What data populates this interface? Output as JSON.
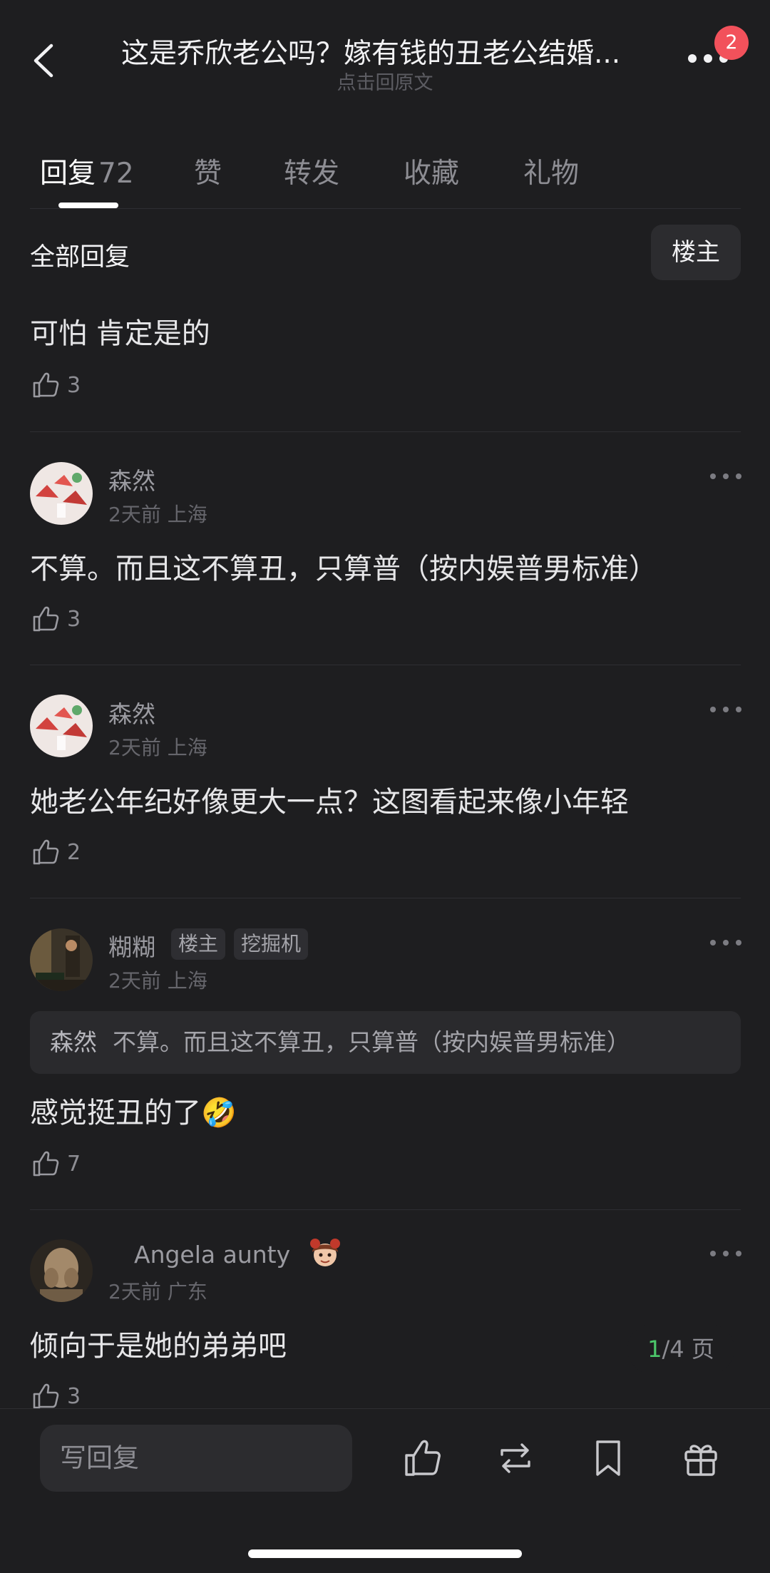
{
  "header": {
    "title": "这是乔欣老公吗？嫁有钱的丑老公结婚...",
    "subtitle": "点击回原文",
    "notification_count": "2"
  },
  "tabs": [
    {
      "label": "回复",
      "count": "72",
      "active": true
    },
    {
      "label": "赞"
    },
    {
      "label": "转发"
    },
    {
      "label": "收藏"
    },
    {
      "label": "礼物"
    }
  ],
  "section": {
    "title": "全部回复",
    "filter_label": "楼主"
  },
  "comments": [
    {
      "text": "可怕 肯定是的",
      "likes": "3"
    },
    {
      "user": "森然",
      "meta": "2天前 上海",
      "text": "不算。而且这不算丑，只算普（按内娱普男标准）",
      "likes": "3"
    },
    {
      "user": "森然",
      "meta": "2天前 上海",
      "text": "她老公年纪好像更大一点？这图看起来像小年轻",
      "likes": "2"
    },
    {
      "user": "糊糊",
      "tags": [
        "楼主",
        "挖掘机"
      ],
      "meta": "2天前 上海",
      "quote_user": "森然",
      "quote_text": "不算。而且这不算丑，只算普（按内娱普男标准）",
      "text": "感觉挺丑的了🤣",
      "likes": "7"
    },
    {
      "user": "Angela aunty",
      "meta": "2天前 广东",
      "text": "倾向于是她的弟弟吧",
      "likes": "3"
    }
  ],
  "pager": {
    "current": "1",
    "total": "/4 页"
  },
  "bottom_bar": {
    "reply_placeholder": "写回复"
  },
  "icons": [
    "back-icon",
    "more-icon",
    "thumb-up-icon",
    "repost-icon",
    "bookmark-icon",
    "gift-icon"
  ],
  "colors": {
    "background": "#1e1e20",
    "badge": "#f2515b",
    "pager_current": "#4cc76a"
  }
}
